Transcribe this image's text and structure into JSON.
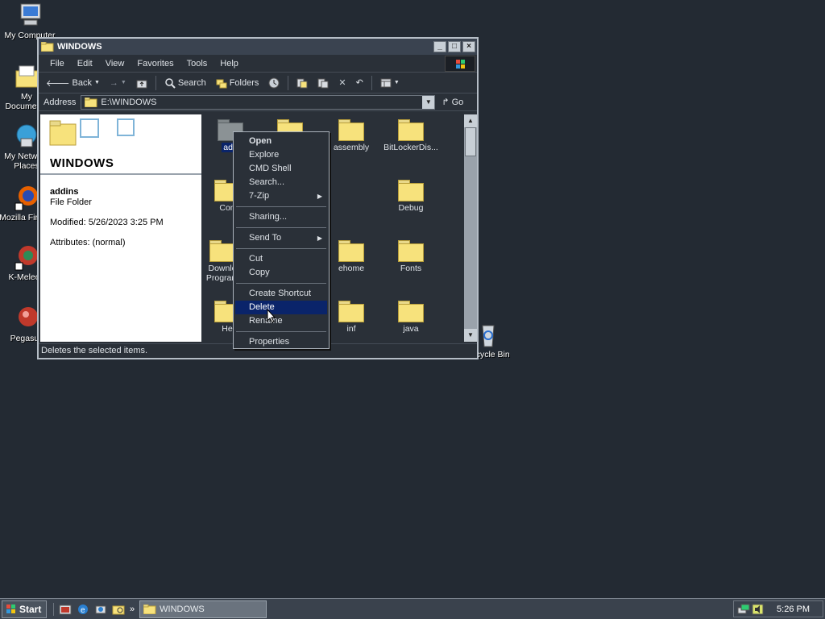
{
  "desktop": {
    "icons": [
      {
        "label": "My Computer"
      },
      {
        "label": "My Documents"
      },
      {
        "label": "My Network Places"
      },
      {
        "label": "Mozilla Firefox"
      },
      {
        "label": "K-Meleon"
      },
      {
        "label": "Pegasus"
      },
      {
        "label": "Recycle Bin"
      }
    ]
  },
  "window": {
    "title": "WINDOWS",
    "controls": {
      "minimize": "_",
      "maximize": "□",
      "close": "×"
    },
    "menu": [
      "File",
      "Edit",
      "View",
      "Favorites",
      "Tools",
      "Help"
    ],
    "toolbar": {
      "back": "Back",
      "search": "Search",
      "folders": "Folders"
    },
    "address": {
      "label": "Address",
      "value": "E:\\WINDOWS",
      "go": "Go"
    },
    "left_pane": {
      "heading": "WINDOWS",
      "selected_name": "addins",
      "selected_type": "File Folder",
      "modified": "Modified: 5/26/2023 3:25 PM",
      "attributes": "Attributes: (normal)"
    },
    "folders": [
      {
        "label": "addins",
        "shown": "add"
      },
      {
        "label": "",
        "shown": ""
      },
      {
        "label": "assembly",
        "shown": "assembly"
      },
      {
        "label": "BitLockerDis...",
        "shown": "BitLockerDis..."
      },
      {
        "label": "Con",
        "shown": "Con"
      },
      {
        "label": "Debug",
        "shown": "Debug"
      },
      {
        "label": "Downl Program",
        "shown": "Downlo"
      },
      {
        "label": "Program",
        "shown": "Program"
      },
      {
        "label": "ehome",
        "shown": "ehome"
      },
      {
        "label": "Fonts",
        "shown": "Fonts"
      },
      {
        "label": "He",
        "shown": "He"
      },
      {
        "label": "inf",
        "shown": "inf"
      },
      {
        "label": "java",
        "shown": "java"
      }
    ],
    "status": "Deletes the selected items."
  },
  "context_menu": {
    "items": [
      {
        "label": "Open",
        "bold": true
      },
      {
        "label": "Explore"
      },
      {
        "label": "CMD Shell"
      },
      {
        "label": "Search..."
      },
      {
        "label": "7-Zip",
        "submenu": true
      },
      {
        "label": "Sharing..."
      },
      {
        "label": "Send To",
        "submenu": true
      },
      {
        "label": "Cut"
      },
      {
        "label": "Copy"
      },
      {
        "label": "Create Shortcut"
      },
      {
        "label": "Delete",
        "highlighted": true
      },
      {
        "label": "Rename"
      },
      {
        "label": "Properties"
      }
    ]
  },
  "taskbar": {
    "start": "Start",
    "task_label": "WINDOWS",
    "quicklaunch_more": "»",
    "clock": "5:26 PM"
  },
  "colors": {
    "desktop": "#232a33",
    "selection": "#0a246a",
    "folder": "#f7e27c"
  }
}
